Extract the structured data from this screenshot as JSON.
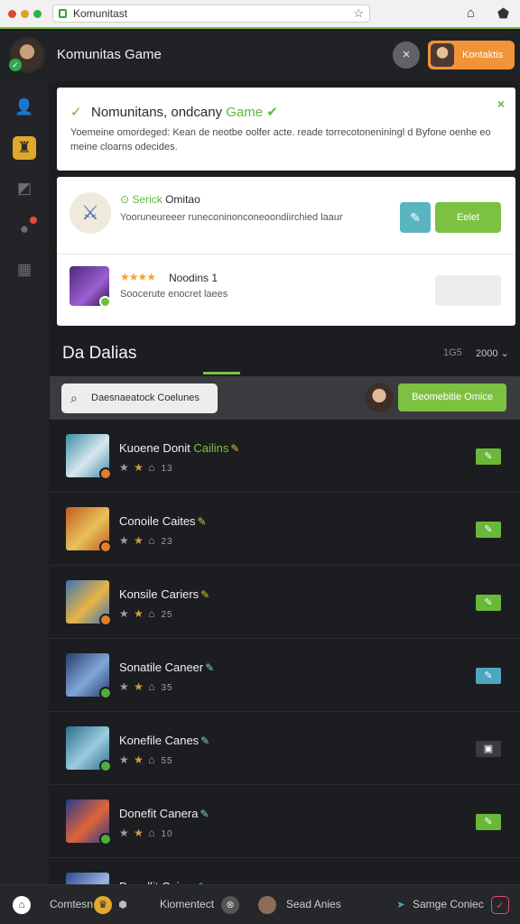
{
  "browser": {
    "url": "Komunitast"
  },
  "header": {
    "title": "Komunitas Game",
    "close_label": "×",
    "action_label": "Kontaktis"
  },
  "notice": {
    "title": "Nomunitans, ondcany",
    "title_highlight": "Game",
    "description": "Yoemeine omordeged: Kean de neotbe oolfer acte. reade torrecotoneniningl d Byfone oenhe eo meine cloarns odecides.",
    "close_label": "×"
  },
  "cards": [
    {
      "title_prefix": "⊙ Serick",
      "title": "Omitao",
      "description": "Yooruneureeer runeconinonconeoondiirchied laaur",
      "icon_button": "✎",
      "button_label": "Eelet"
    },
    {
      "stars": "★★★★",
      "title": "Noodins 1",
      "description": "Soocerute enocret laees"
    }
  ],
  "section": {
    "title": "Da Dalias",
    "count": "1G5",
    "sort": "2000 ⌄"
  },
  "search": {
    "placeholder": "Daesnaeatock Coelunes",
    "button_label": "Beomebitie Omice"
  },
  "games": [
    {
      "name": "Kuoene Donit",
      "highlight": "Cailins",
      "count": "13",
      "thumb": [
        "#3d8ea8",
        "#d9e7ee"
      ],
      "badge": "#e47c2a",
      "action": "#6ab83a",
      "action_icon": "✎"
    },
    {
      "name": "Conoile Caites",
      "highlight": "",
      "count": "23",
      "thumb": [
        "#c05a23",
        "#e8c25a"
      ],
      "badge": "#e47c2a",
      "action": "#6ab83a",
      "action_icon": "✎"
    },
    {
      "name": "Konsile Cariers",
      "highlight": "",
      "count": "25",
      "thumb": [
        "#3e74b5",
        "#e8b445"
      ],
      "badge": "#e47c2a",
      "action": "#6ab83a",
      "action_icon": "✎"
    },
    {
      "name": "Sonatile Caneer",
      "highlight": "",
      "count": "35",
      "thumb": [
        "#2b3c6e",
        "#7fa7d8"
      ],
      "badge": "#4fae3a",
      "action": "#4ea7c0",
      "action_icon": "✎"
    },
    {
      "name": "Konefile Canes",
      "highlight": "",
      "count": "55",
      "thumb": [
        "#2a6e8f",
        "#9ccce0"
      ],
      "badge": "#4fae3a",
      "action": "#3b3c40",
      "action_icon": "▣"
    },
    {
      "name": "Donefit Canera",
      "highlight": "",
      "count": "10",
      "thumb": [
        "#2a3a8a",
        "#e0643a"
      ],
      "badge": "#4fae3a",
      "action": "#6ab83a",
      "action_icon": "✎"
    },
    {
      "name": "Donallit Caieer",
      "highlight": "",
      "count": "",
      "thumb": [
        "#2d4a8f",
        "#9bb4e0"
      ],
      "badge": "#4fae3a",
      "action": "#6ab83a",
      "action_icon": "✎"
    }
  ],
  "bottom": {
    "item1": "Comtesn",
    "item2": "Kiomentect",
    "item3": "Sead Anies",
    "item4": "Samge Coniec"
  },
  "colors": {
    "accent": "#7cc142",
    "orange": "#f19338",
    "teal": "#5ab5c1",
    "background": "#1c1d20"
  }
}
